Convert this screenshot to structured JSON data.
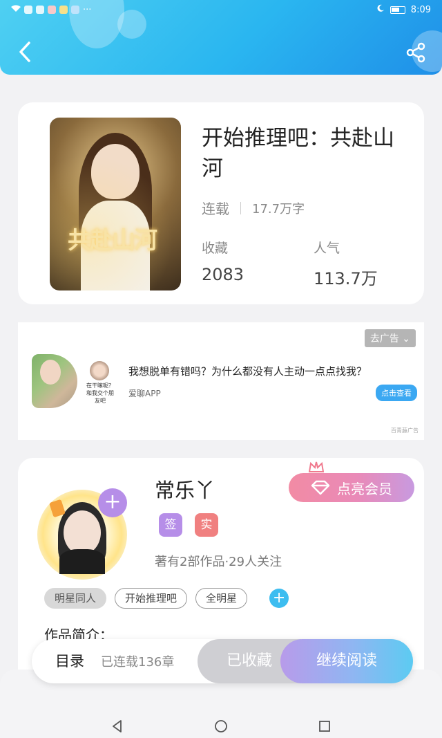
{
  "status_bar": {
    "time": "8:09",
    "dots": "···"
  },
  "book": {
    "title": "开始推理吧：共赴山河",
    "status": "连载",
    "word_count": "17.7万字",
    "favorites_label": "收藏",
    "favorites_value": "2083",
    "popularity_label": "人气",
    "popularity_value": "113.7万",
    "cover_logo": "共赴山河"
  },
  "ad": {
    "close_label": "去广告",
    "headline": "我想脱单有错吗？为什么都没有人主动一点点找我？",
    "source": "爱聊APP",
    "cta": "点击查看",
    "mark": "百青藤广告",
    "sub_text": "在干嘛呢？和我交个朋友吧"
  },
  "author": {
    "name": "常乐丫",
    "vip_label": "点亮会员",
    "badge_sign": "签",
    "badge_real": "实",
    "stats": "著有2部作品·29人关注",
    "tags": [
      "明星同人",
      "开始推理吧",
      "全明星"
    ],
    "intro_label": "作品简介："
  },
  "bottom_bar": {
    "toc_label": "目录",
    "toc_count": "已连载136章",
    "collected_label": "已收藏",
    "continue_label": "继续阅读"
  },
  "colors": {
    "header_blue": "#2ab6f0",
    "vip_pink": "#f28ba4",
    "badge_purple": "#b68ee8",
    "badge_red": "#f08080",
    "accent_cyan": "#3dbdf0"
  }
}
